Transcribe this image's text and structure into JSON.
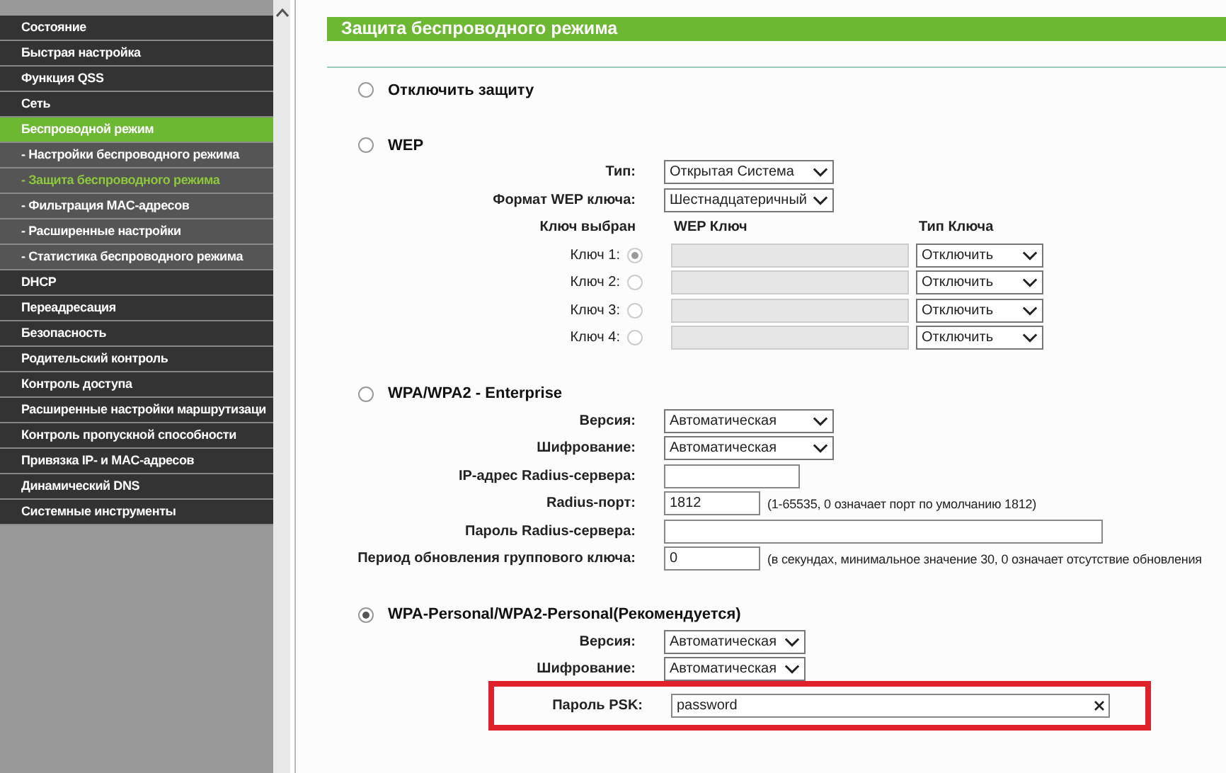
{
  "sidebar": {
    "items": [
      {
        "label": "Состояние",
        "kind": "main",
        "selected": false
      },
      {
        "label": "Быстрая настройка",
        "kind": "main",
        "selected": false
      },
      {
        "label": "Функция QSS",
        "kind": "main",
        "selected": false
      },
      {
        "label": "Сеть",
        "kind": "main",
        "selected": false
      },
      {
        "label": "Беспроводной режим",
        "kind": "main",
        "selected": true
      },
      {
        "label": "- Настройки беспроводного режима",
        "kind": "sub",
        "selected": false
      },
      {
        "label": "- Защита беспроводного режима",
        "kind": "sub",
        "selected": true
      },
      {
        "label": "- Фильтрация MAC-адресов",
        "kind": "sub",
        "selected": false
      },
      {
        "label": "- Расширенные настройки",
        "kind": "sub",
        "selected": false
      },
      {
        "label": "- Статистика беспроводного режима",
        "kind": "sub",
        "selected": false
      },
      {
        "label": "DHCP",
        "kind": "main",
        "selected": false
      },
      {
        "label": "Переадресация",
        "kind": "main",
        "selected": false
      },
      {
        "label": "Безопасность",
        "kind": "main",
        "selected": false
      },
      {
        "label": "Родительский контроль",
        "kind": "main",
        "selected": false
      },
      {
        "label": "Контроль доступа",
        "kind": "main",
        "selected": false
      },
      {
        "label": "Расширенные настройки маршрутизаци",
        "kind": "main",
        "selected": false
      },
      {
        "label": "Контроль пропускной способности",
        "kind": "main",
        "selected": false
      },
      {
        "label": "Привязка IP- и MAC-адресов",
        "kind": "main",
        "selected": false
      },
      {
        "label": "Динамический DNS",
        "kind": "main",
        "selected": false
      },
      {
        "label": "Системные инструменты",
        "kind": "main",
        "selected": false
      }
    ]
  },
  "page": {
    "title": "Защита беспроводного режима",
    "modes": [
      {
        "label": "Отключить защиту",
        "selected": false
      },
      {
        "label": "WEP",
        "selected": false,
        "fields": [
          {
            "kind": "select",
            "label": "Тип:",
            "value": "Открытая Система"
          },
          {
            "kind": "select",
            "label": "Формат WEP ключа:",
            "value": "Шестнадцатеричный"
          }
        ],
        "keys": {
          "headers": [
            "Ключ выбран",
            "WEP Ключ",
            "Тип Ключа"
          ],
          "rows": [
            {
              "label": "Ключ 1:",
              "selected": true,
              "type": "Отключить"
            },
            {
              "label": "Ключ 2:",
              "selected": false,
              "type": "Отключить"
            },
            {
              "label": "Ключ 3:",
              "selected": false,
              "type": "Отключить"
            },
            {
              "label": "Ключ 4:",
              "selected": false,
              "type": "Отключить"
            }
          ]
        }
      },
      {
        "label": "WPA/WPA2 - Enterprise",
        "selected": false,
        "fields": [
          {
            "kind": "select",
            "label": "Версия:",
            "value": "Автоматическая"
          },
          {
            "kind": "select",
            "label": "Шифрование:",
            "value": "Автоматическая"
          },
          {
            "kind": "input",
            "label": "IP-адрес Radius-сервера:"
          },
          {
            "kind": "input",
            "label": "Radius-порт:",
            "value": "1812",
            "hint": "(1-65535, 0 означает порт по умолчанию 1812)"
          },
          {
            "kind": "input",
            "label": "Пароль Radius-сервера:"
          },
          {
            "kind": "input",
            "label": "Период обновления группового ключа:",
            "value": "0",
            "hint": "(в секундах, минимальное значение 30, 0 означает отсутствие обновления"
          }
        ]
      },
      {
        "label": "WPA-Personal/WPA2-Personal(Рекомендуется)",
        "selected": true,
        "fields": [
          {
            "kind": "select",
            "label": "Версия:",
            "value": "Автоматическая"
          },
          {
            "kind": "select",
            "label": "Шифрование:",
            "value": "Автоматическая"
          },
          {
            "kind": "input",
            "label": "Пароль PSK:",
            "value": "password",
            "highlighted": true
          }
        ]
      }
    ]
  }
}
